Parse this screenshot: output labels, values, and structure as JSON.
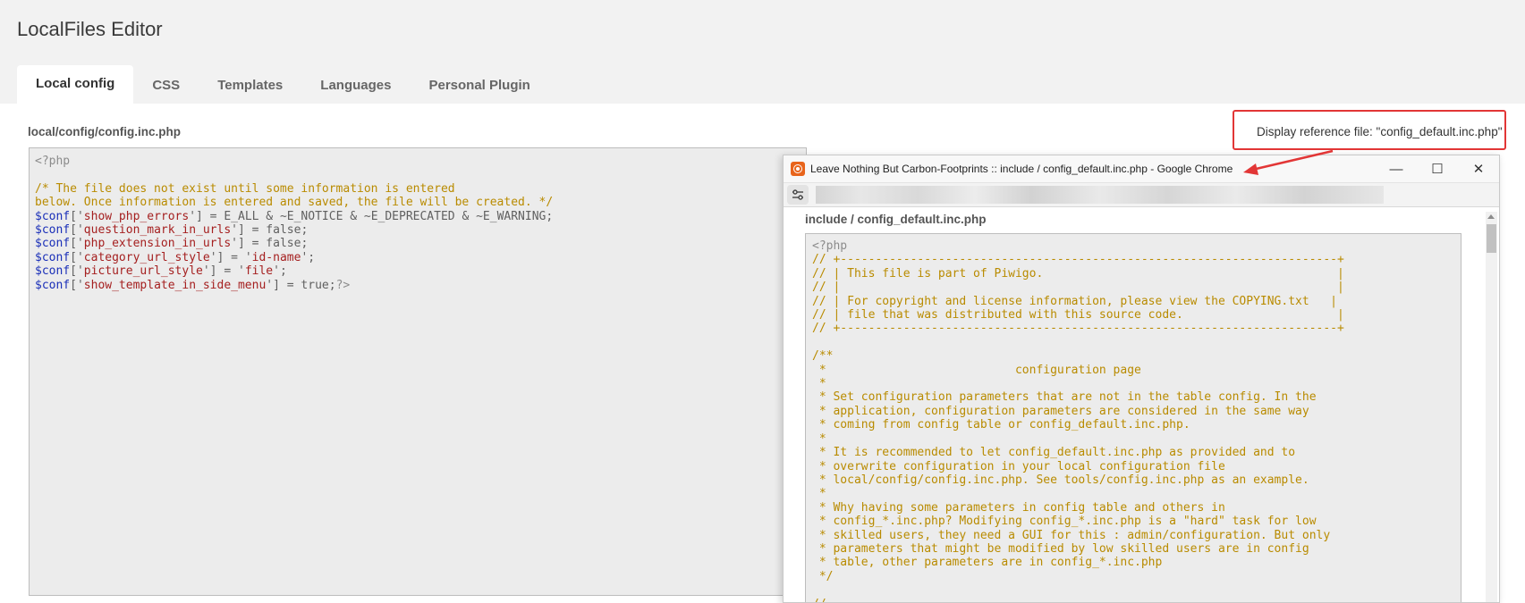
{
  "page": {
    "title": "LocalFiles Editor"
  },
  "tabs": [
    {
      "label": "Local config",
      "active": true
    },
    {
      "label": "CSS"
    },
    {
      "label": "Templates"
    },
    {
      "label": "Languages"
    },
    {
      "label": "Personal Plugin"
    }
  ],
  "editor": {
    "file_path": "local/config/config.inc.php",
    "reference_link": "Display reference file: \"config_default.inc.php\"",
    "lines": [
      [
        {
          "t": "<?php",
          "c": "gray"
        }
      ],
      [
        {
          "t": "",
          "c": "plain"
        }
      ],
      [
        {
          "t": "/* The file does not exist until some information is entered",
          "c": "comment"
        }
      ],
      [
        {
          "t": "below. Once information is entered and saved, the file will be created. */",
          "c": "comment"
        }
      ],
      [
        {
          "t": "$conf",
          "c": "var"
        },
        {
          "t": "['",
          "c": "plain"
        },
        {
          "t": "show_php_errors",
          "c": "str"
        },
        {
          "t": "'] = E_ALL & ~E_NOTICE & ~E_DEPRECATED & ~E_WARNING;",
          "c": "plain"
        }
      ],
      [
        {
          "t": "$conf",
          "c": "var"
        },
        {
          "t": "['",
          "c": "plain"
        },
        {
          "t": "question_mark_in_urls",
          "c": "str"
        },
        {
          "t": "'] = false;",
          "c": "plain"
        }
      ],
      [
        {
          "t": "$conf",
          "c": "var"
        },
        {
          "t": "['",
          "c": "plain"
        },
        {
          "t": "php_extension_in_urls",
          "c": "str"
        },
        {
          "t": "'] = false;",
          "c": "plain"
        }
      ],
      [
        {
          "t": "$conf",
          "c": "var"
        },
        {
          "t": "['",
          "c": "plain"
        },
        {
          "t": "category_url_style",
          "c": "str"
        },
        {
          "t": "'] = '",
          "c": "plain"
        },
        {
          "t": "id-name",
          "c": "str"
        },
        {
          "t": "';",
          "c": "plain"
        }
      ],
      [
        {
          "t": "$conf",
          "c": "var"
        },
        {
          "t": "['",
          "c": "plain"
        },
        {
          "t": "picture_url_style",
          "c": "str"
        },
        {
          "t": "'] = '",
          "c": "plain"
        },
        {
          "t": "file",
          "c": "str"
        },
        {
          "t": "';",
          "c": "plain"
        }
      ],
      [
        {
          "t": "$conf",
          "c": "var"
        },
        {
          "t": "['",
          "c": "plain"
        },
        {
          "t": "show_template_in_side_menu",
          "c": "str"
        },
        {
          "t": "'] = true;",
          "c": "plain"
        },
        {
          "t": "?>",
          "c": "gray"
        }
      ]
    ]
  },
  "browser": {
    "window_title": "Leave Nothing But Carbon-Footprints :: include / config_default.inc.php - Google Chrome",
    "minimize": "—",
    "maximize": "☐",
    "close": "✕",
    "icons": {
      "app": "chrome-app-icon",
      "site_settings": "tune-icon"
    },
    "reference_title": "include / config_default.inc.php",
    "reference_lines": [
      "<?php",
      "// +-----------------------------------------------------------------------+",
      "// | This file is part of Piwigo.                                          |",
      "// |                                                                       |",
      "// | For copyright and license information, please view the COPYING.txt   |",
      "// | file that was distributed with this source code.                      |",
      "// +-----------------------------------------------------------------------+",
      "",
      "/**",
      " *                           configuration page",
      " *",
      " * Set configuration parameters that are not in the table config. In the",
      " * application, configuration parameters are considered in the same way",
      " * coming from config table or config_default.inc.php.",
      " *",
      " * It is recommended to let config_default.inc.php as provided and to",
      " * overwrite configuration in your local configuration file",
      " * local/config/config.inc.php. See tools/config.inc.php as an example.",
      " *",
      " * Why having some parameters in config table and others in",
      " * config_*.inc.php? Modifying config_*.inc.php is a \"hard\" task for low",
      " * skilled users, they need a GUI for this : admin/configuration. But only",
      " * parameters that might be modified by low skilled users are in config",
      " * table, other parameters are in config_*.inc.php",
      " */",
      "",
      "//"
    ]
  },
  "colors": {
    "highlight": "#e23636",
    "comment": "#b98b00",
    "variable": "#1a2fb8",
    "string": "#a52020"
  }
}
